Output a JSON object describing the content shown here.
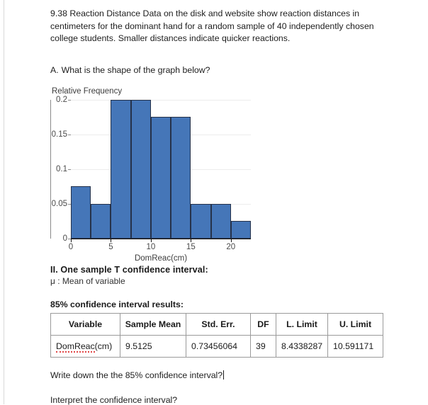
{
  "document": {
    "prompt": "9.38 Reaction Distance Data on the disk and website show reaction distances in centimeters for the dominant hand for a random sample of 40 independently chosen college students. Smaller distances indicate quicker reactions.",
    "question_a_label": "A.",
    "question_a_text": "What is the shape of the graph below?",
    "section_ii_title": "II. One sample T confidence interval:",
    "section_ii_subtitle": "μ : Mean of variable",
    "ci_heading": "85% confidence interval results:",
    "question_write": "Write down the the 85% confidence interval?",
    "question_interpret": "Interpret the confidence interval?"
  },
  "chart_data": {
    "type": "bar",
    "title": "",
    "ylabel": "Relative Frequency",
    "xlabel": "DomReac(cm)",
    "bin_width": 2.5,
    "bin_starts": [
      0,
      2.5,
      5,
      7.5,
      10,
      12.5,
      15,
      17.5,
      20
    ],
    "categories": [
      "0-2.5",
      "2.5-5",
      "5-7.5",
      "7.5-10",
      "10-12.5",
      "12.5-15",
      "15-17.5",
      "17.5-20",
      "20-22.5"
    ],
    "values": [
      0.075,
      0.05,
      0.2,
      0.2,
      0.175,
      0.175,
      0.05,
      0.05,
      0.025
    ],
    "xlim": [
      0,
      22.5
    ],
    "ylim": [
      0,
      0.2
    ],
    "xticks": [
      0,
      5,
      10,
      15,
      20
    ],
    "xtick_labels": [
      "0",
      "5",
      "10",
      "15",
      "20"
    ],
    "yticks": [
      0,
      0.05,
      0.1,
      0.15,
      0.2
    ],
    "ytick_labels": [
      "0",
      "0.05",
      "0.1",
      "0.15",
      "0.2"
    ],
    "grid": true,
    "legend": false,
    "bar_color": "#4576b8",
    "bar_edge_color": "#26324a"
  },
  "results_table": {
    "headers": [
      "Variable",
      "Sample Mean",
      "Std. Err.",
      "DF",
      "L. Limit",
      "U. Limit"
    ],
    "rows": [
      {
        "variable_misspelled": "DomReac",
        "variable_suffix": "(cm)",
        "sample_mean": "9.5125",
        "std_err": "0.73456064",
        "df": "39",
        "l_limit": "8.4338287",
        "u_limit": "10.591171"
      }
    ]
  }
}
